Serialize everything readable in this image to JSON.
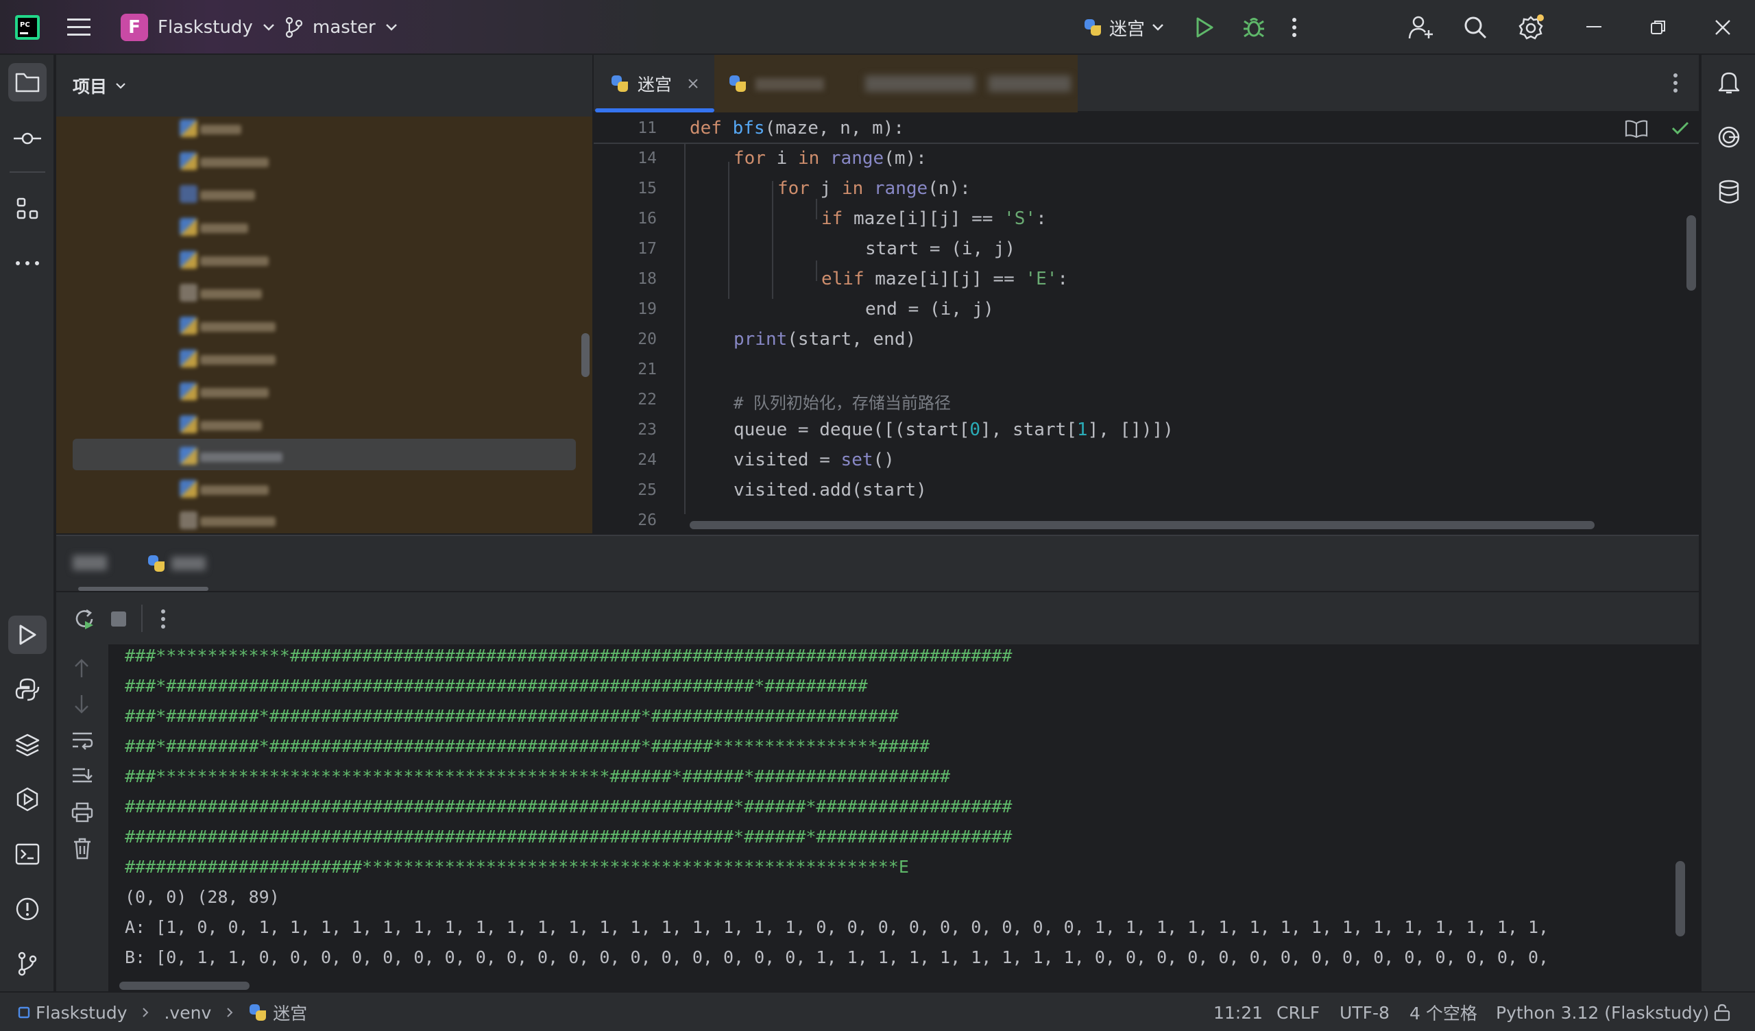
{
  "titlebar": {
    "project_badge": "F",
    "project_name": "Flaskstudy",
    "branch": "master",
    "run_config": "迷宫"
  },
  "project_panel": {
    "title": "项目"
  },
  "editor": {
    "active_tab": "迷宫",
    "sticky": {
      "line": "11",
      "code": "def bfs(maze, n, m):"
    },
    "lines": [
      {
        "n": "14"
      },
      {
        "n": "15"
      },
      {
        "n": "16"
      },
      {
        "n": "17"
      },
      {
        "n": "18"
      },
      {
        "n": "19"
      },
      {
        "n": "20"
      },
      {
        "n": "21"
      },
      {
        "n": "22"
      },
      {
        "n": "23"
      },
      {
        "n": "24"
      },
      {
        "n": "25"
      },
      {
        "n": "26"
      }
    ],
    "code": {
      "l14_a": "for",
      "l14_b": " i ",
      "l14_c": "in",
      "l14_d": "range",
      "l14_e": "(m):",
      "l15_a": "for",
      "l15_b": " j ",
      "l15_c": "in",
      "l15_d": "range",
      "l15_e": "(n):",
      "l16_a": "if",
      "l16_b": " maze[i][j] == ",
      "l16_c": "'S'",
      "l16_d": ":",
      "l17": "start = (i, j)",
      "l18_a": "elif",
      "l18_b": " maze[i][j] == ",
      "l18_c": "'E'",
      "l18_d": ":",
      "l19": "end = (i, j)",
      "l20_a": "print",
      "l20_b": "(start, end)",
      "l22": "# 队列初始化，存储当前路径",
      "l23_a": "queue = deque([(start[",
      "l23_b": "0",
      "l23_c": "], start[",
      "l23_d": "1",
      "l23_e": "], [])])",
      "l24_a": "visited = ",
      "l24_b": "set",
      "l24_c": "()",
      "l25": "visited.add(start)"
    }
  },
  "console": {
    "maze_lines": [
      "###*************######################################################################",
      "###*#########################################################*##########",
      "###*#########*####################################*########################",
      "###*#########*####################################*######****************#####",
      "###********************************************######*######*###################",
      "###########################################################*######*###################",
      "###########################################################*######*###################",
      "#######################****************************************************E"
    ],
    "start_end": "(0, 0) (28, 89)",
    "row_a": "A: [1, 0, 0, 1, 1, 1, 1, 1, 1, 1, 1, 1, 1, 1, 1, 1, 1, 1, 1, 1, 1, 0, 0, 0, 0, 0, 0, 0, 0, 0, 1, 1, 1, 1, 1, 1, 1, 1, 1, 1, 1, 1, 1, 1, 1,",
    "row_b": "B: [0, 1, 1, 0, 0, 0, 0, 0, 0, 0, 0, 0, 0, 0, 0, 0, 0, 0, 0, 0, 0, 1, 1, 1, 1, 1, 1, 1, 1, 1, 0, 0, 0, 0, 0, 0, 0, 0, 0, 0, 0, 0, 0, 0, 0,"
  },
  "statusbar": {
    "crumb_project": "Flaskstudy",
    "crumb_venv": ".venv",
    "crumb_file": "迷宫",
    "position": "11:21",
    "line_sep": "CRLF",
    "encoding": "UTF-8",
    "indent": "4 个空格",
    "interpreter": "Python 3.12 (Flaskstudy)"
  },
  "colors": {
    "accent": "#3574f0",
    "run_green": "#5fb86a",
    "project_badge": "#c94aa5"
  }
}
